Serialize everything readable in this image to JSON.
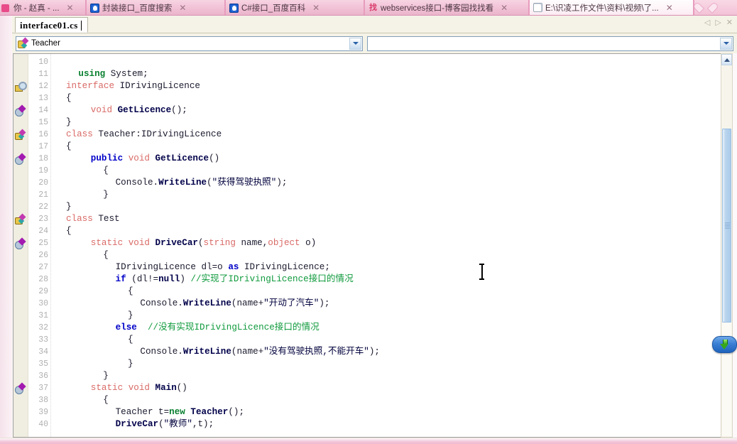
{
  "browser": {
    "tabs": [
      {
        "title": "你 - 赵真 - ...",
        "favicon": "pink-square-icon",
        "closable": true,
        "active": false
      },
      {
        "title": "封装接口_百度搜索",
        "favicon": "baidu-paw-icon",
        "closable": true,
        "active": false
      },
      {
        "title": "C#接口_百度百科",
        "favicon": "baidu-paw-icon",
        "closable": true,
        "active": false
      },
      {
        "title": "webservices接口-博客园找找看",
        "favicon": "zhao-zhao-kan-icon",
        "closable": true,
        "active": false
      },
      {
        "title": "E:\\识凌工作文件\\资料\\视频\\了...",
        "favicon": "document-icon",
        "closable": true,
        "active": true
      }
    ],
    "new_tab_icon": "heart-icon"
  },
  "ide": {
    "document_tab": {
      "label": "interface01.cs",
      "modified": false
    },
    "tab_nav": {
      "prev": "◁",
      "next": "▷",
      "close": "✕"
    },
    "navigation_bar": {
      "type_combo": {
        "value": "Teacher",
        "icon": "class-icon",
        "arrow": "chevron-down-icon"
      },
      "member_combo": {
        "value": "",
        "arrow": "chevron-down-icon"
      }
    },
    "scrollbar": {
      "up_button": "scroll-up-icon",
      "thumb_top_pct": 17,
      "thumb_height_pct": 52
    },
    "scroll_down_pill": {
      "icon": "green-down-arrow-icon",
      "label": ""
    }
  },
  "editor": {
    "first_visible_line": 10,
    "last_visible_line": 40,
    "lines": [
      {
        "n": 10,
        "glyph": null,
        "fold": null,
        "indent": 0,
        "tokens": []
      },
      {
        "n": 11,
        "glyph": null,
        "fold": null,
        "indent": 1,
        "tokens": [
          {
            "t": "using",
            "c": "k-green"
          },
          {
            "t": " System;",
            "c": "plain"
          }
        ]
      },
      {
        "n": 12,
        "glyph": "interface-icon",
        "fold": "open",
        "indent": 0,
        "tokens": [
          {
            "t": "interface",
            "c": "k-red"
          },
          {
            "t": " IDrivingLicence",
            "c": "plain"
          }
        ]
      },
      {
        "n": 13,
        "glyph": null,
        "fold": "line",
        "indent": 0,
        "tokens": [
          {
            "t": "{",
            "c": "plain"
          }
        ]
      },
      {
        "n": 14,
        "glyph": "method-purple-icon",
        "fold": "line",
        "indent": 2,
        "tokens": [
          {
            "t": "void",
            "c": "k-red"
          },
          {
            "t": " ",
            "c": "plain"
          },
          {
            "t": "GetLicence",
            "c": "bold-navy"
          },
          {
            "t": "();",
            "c": "plain"
          }
        ]
      },
      {
        "n": 15,
        "glyph": null,
        "fold": "end",
        "indent": 0,
        "tokens": [
          {
            "t": "}",
            "c": "plain"
          }
        ]
      },
      {
        "n": 16,
        "glyph": "class-icon",
        "fold": "open",
        "indent": 0,
        "tokens": [
          {
            "t": "class",
            "c": "k-red"
          },
          {
            "t": " Teacher:IDrivingLicence",
            "c": "plain"
          }
        ]
      },
      {
        "n": 17,
        "glyph": null,
        "fold": "line",
        "indent": 0,
        "tokens": [
          {
            "t": "{",
            "c": "plain"
          }
        ]
      },
      {
        "n": 18,
        "glyph": "method-purple-icon",
        "fold": "open2",
        "indent": 2,
        "tokens": [
          {
            "t": "public",
            "c": "k-blue"
          },
          {
            "t": " ",
            "c": "plain"
          },
          {
            "t": "void",
            "c": "k-red"
          },
          {
            "t": " ",
            "c": "plain"
          },
          {
            "t": "GetLicence",
            "c": "bold-navy"
          },
          {
            "t": "()",
            "c": "plain"
          }
        ]
      },
      {
        "n": 19,
        "glyph": null,
        "fold": "line2",
        "indent": 3,
        "tokens": [
          {
            "t": "{",
            "c": "plain"
          }
        ]
      },
      {
        "n": 20,
        "glyph": null,
        "fold": "line2",
        "indent": 4,
        "tokens": [
          {
            "t": "Console.",
            "c": "plain"
          },
          {
            "t": "WriteLine",
            "c": "bold-navy"
          },
          {
            "t": "(",
            "c": "plain"
          },
          {
            "t": "\"获得驾驶执照\"",
            "c": "str"
          },
          {
            "t": ");",
            "c": "plain"
          }
        ]
      },
      {
        "n": 21,
        "glyph": null,
        "fold": "end2",
        "indent": 3,
        "tokens": [
          {
            "t": "}",
            "c": "plain"
          }
        ]
      },
      {
        "n": 22,
        "glyph": null,
        "fold": "end",
        "indent": 0,
        "tokens": [
          {
            "t": "}",
            "c": "plain"
          }
        ]
      },
      {
        "n": 23,
        "glyph": "class-icon",
        "fold": "open",
        "indent": 0,
        "tokens": [
          {
            "t": "class",
            "c": "k-red"
          },
          {
            "t": " Test",
            "c": "plain"
          }
        ]
      },
      {
        "n": 24,
        "glyph": null,
        "fold": "line",
        "indent": 0,
        "tokens": [
          {
            "t": "{",
            "c": "plain"
          }
        ]
      },
      {
        "n": 25,
        "glyph": "method-purple-icon",
        "fold": "open2",
        "indent": 2,
        "tokens": [
          {
            "t": "static",
            "c": "k-red"
          },
          {
            "t": " ",
            "c": "plain"
          },
          {
            "t": "void",
            "c": "k-red"
          },
          {
            "t": " ",
            "c": "plain"
          },
          {
            "t": "DriveCar",
            "c": "bold-navy"
          },
          {
            "t": "(",
            "c": "plain"
          },
          {
            "t": "string",
            "c": "k-red"
          },
          {
            "t": " name,",
            "c": "plain"
          },
          {
            "t": "object",
            "c": "k-red"
          },
          {
            "t": " o)",
            "c": "plain"
          }
        ]
      },
      {
        "n": 26,
        "glyph": null,
        "fold": "line2",
        "indent": 3,
        "tokens": [
          {
            "t": "{",
            "c": "plain"
          }
        ]
      },
      {
        "n": 27,
        "glyph": null,
        "fold": "line2",
        "indent": 4,
        "tokens": [
          {
            "t": "IDrivingLicence dl=o ",
            "c": "plain"
          },
          {
            "t": "as",
            "c": "k-blue"
          },
          {
            "t": " IDrivingLicence;",
            "c": "plain"
          }
        ]
      },
      {
        "n": 28,
        "glyph": null,
        "fold": "line2",
        "indent": 4,
        "tokens": [
          {
            "t": "if",
            "c": "k-blue"
          },
          {
            "t": " (dl!=",
            "c": "plain"
          },
          {
            "t": "null",
            "c": "bold-navy"
          },
          {
            "t": ") ",
            "c": "plain"
          },
          {
            "t": "//实现了IDrivingLicence接口的情况",
            "c": "comment"
          }
        ]
      },
      {
        "n": 29,
        "glyph": null,
        "fold": "line2",
        "indent": 5,
        "tokens": [
          {
            "t": "{",
            "c": "plain"
          }
        ]
      },
      {
        "n": 30,
        "glyph": null,
        "fold": "line2",
        "indent": 6,
        "tokens": [
          {
            "t": "Console.",
            "c": "plain"
          },
          {
            "t": "WriteLine",
            "c": "bold-navy"
          },
          {
            "t": "(name+",
            "c": "plain"
          },
          {
            "t": "\"开动了汽车\"",
            "c": "str"
          },
          {
            "t": ");",
            "c": "plain"
          }
        ]
      },
      {
        "n": 31,
        "glyph": null,
        "fold": "line2",
        "indent": 5,
        "tokens": [
          {
            "t": "}",
            "c": "plain"
          }
        ]
      },
      {
        "n": 32,
        "glyph": null,
        "fold": "line2",
        "indent": 4,
        "tokens": [
          {
            "t": "else",
            "c": "k-blue"
          },
          {
            "t": "  ",
            "c": "plain"
          },
          {
            "t": "//没有实现IDrivingLicence接口的情况",
            "c": "comment"
          }
        ]
      },
      {
        "n": 33,
        "glyph": null,
        "fold": "line2",
        "indent": 5,
        "tokens": [
          {
            "t": "{",
            "c": "plain"
          }
        ]
      },
      {
        "n": 34,
        "glyph": null,
        "fold": "line2",
        "indent": 6,
        "tokens": [
          {
            "t": "Console.",
            "c": "plain"
          },
          {
            "t": "WriteLine",
            "c": "bold-navy"
          },
          {
            "t": "(name+",
            "c": "plain"
          },
          {
            "t": "\"没有驾驶执照,不能开车\"",
            "c": "str"
          },
          {
            "t": ");",
            "c": "plain"
          }
        ]
      },
      {
        "n": 35,
        "glyph": null,
        "fold": "line2",
        "indent": 5,
        "tokens": [
          {
            "t": "}",
            "c": "plain"
          }
        ]
      },
      {
        "n": 36,
        "glyph": null,
        "fold": "end2",
        "indent": 3,
        "tokens": [
          {
            "t": "}",
            "c": "plain"
          }
        ]
      },
      {
        "n": 37,
        "glyph": "method-purple-icon",
        "fold": "open2",
        "indent": 2,
        "tokens": [
          {
            "t": "static",
            "c": "k-red"
          },
          {
            "t": " ",
            "c": "plain"
          },
          {
            "t": "void",
            "c": "k-red"
          },
          {
            "t": " ",
            "c": "plain"
          },
          {
            "t": "Main",
            "c": "bold-navy"
          },
          {
            "t": "()",
            "c": "plain"
          }
        ]
      },
      {
        "n": 38,
        "glyph": null,
        "fold": "line2",
        "indent": 3,
        "tokens": [
          {
            "t": "{",
            "c": "plain"
          }
        ]
      },
      {
        "n": 39,
        "glyph": null,
        "fold": "line2",
        "indent": 4,
        "tokens": [
          {
            "t": "Teacher t=",
            "c": "plain"
          },
          {
            "t": "new",
            "c": "k-green"
          },
          {
            "t": " ",
            "c": "plain"
          },
          {
            "t": "Teacher",
            "c": "bold-navy"
          },
          {
            "t": "();",
            "c": "plain"
          }
        ]
      },
      {
        "n": 40,
        "glyph": null,
        "fold": "line2",
        "indent": 4,
        "tokens": [
          {
            "t": "DriveCar",
            "c": "bold-navy"
          },
          {
            "t": "(",
            "c": "plain"
          },
          {
            "t": "\"教师\"",
            "c": "str"
          },
          {
            "t": ",t);",
            "c": "plain"
          }
        ]
      }
    ]
  },
  "colors": {
    "keyword_blue": "#0000c8",
    "type_red": "#d96a66",
    "keyword_green": "#0a8030",
    "comment_green": "#0f9a3c",
    "string_navy": "#00003c",
    "linenumber_gray": "#b0b0b0",
    "tabstrip_pink": "#f3c2d6",
    "ide_chrome": "#f5f3e7",
    "scroll_pill_blue": "#3a7fd4",
    "scroll_pill_arrow_green": "#35a81b"
  }
}
